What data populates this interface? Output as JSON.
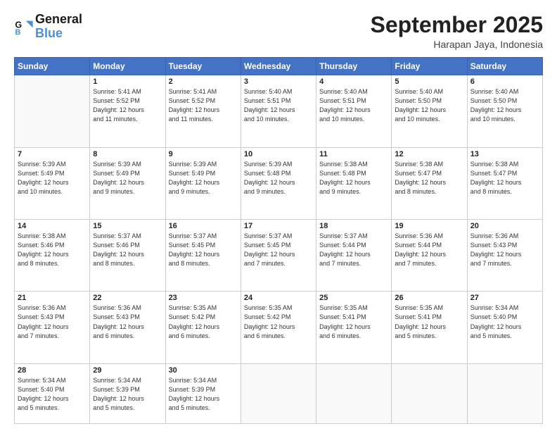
{
  "header": {
    "logo_line1": "General",
    "logo_line2": "Blue",
    "month": "September 2025",
    "location": "Harapan Jaya, Indonesia"
  },
  "days_of_week": [
    "Sunday",
    "Monday",
    "Tuesday",
    "Wednesday",
    "Thursday",
    "Friday",
    "Saturday"
  ],
  "weeks": [
    [
      {
        "day": "",
        "info": ""
      },
      {
        "day": "1",
        "info": "Sunrise: 5:41 AM\nSunset: 5:52 PM\nDaylight: 12 hours\nand 11 minutes."
      },
      {
        "day": "2",
        "info": "Sunrise: 5:41 AM\nSunset: 5:52 PM\nDaylight: 12 hours\nand 11 minutes."
      },
      {
        "day": "3",
        "info": "Sunrise: 5:40 AM\nSunset: 5:51 PM\nDaylight: 12 hours\nand 10 minutes."
      },
      {
        "day": "4",
        "info": "Sunrise: 5:40 AM\nSunset: 5:51 PM\nDaylight: 12 hours\nand 10 minutes."
      },
      {
        "day": "5",
        "info": "Sunrise: 5:40 AM\nSunset: 5:50 PM\nDaylight: 12 hours\nand 10 minutes."
      },
      {
        "day": "6",
        "info": "Sunrise: 5:40 AM\nSunset: 5:50 PM\nDaylight: 12 hours\nand 10 minutes."
      }
    ],
    [
      {
        "day": "7",
        "info": "Sunrise: 5:39 AM\nSunset: 5:49 PM\nDaylight: 12 hours\nand 10 minutes."
      },
      {
        "day": "8",
        "info": "Sunrise: 5:39 AM\nSunset: 5:49 PM\nDaylight: 12 hours\nand 9 minutes."
      },
      {
        "day": "9",
        "info": "Sunrise: 5:39 AM\nSunset: 5:49 PM\nDaylight: 12 hours\nand 9 minutes."
      },
      {
        "day": "10",
        "info": "Sunrise: 5:39 AM\nSunset: 5:48 PM\nDaylight: 12 hours\nand 9 minutes."
      },
      {
        "day": "11",
        "info": "Sunrise: 5:38 AM\nSunset: 5:48 PM\nDaylight: 12 hours\nand 9 minutes."
      },
      {
        "day": "12",
        "info": "Sunrise: 5:38 AM\nSunset: 5:47 PM\nDaylight: 12 hours\nand 8 minutes."
      },
      {
        "day": "13",
        "info": "Sunrise: 5:38 AM\nSunset: 5:47 PM\nDaylight: 12 hours\nand 8 minutes."
      }
    ],
    [
      {
        "day": "14",
        "info": "Sunrise: 5:38 AM\nSunset: 5:46 PM\nDaylight: 12 hours\nand 8 minutes."
      },
      {
        "day": "15",
        "info": "Sunrise: 5:37 AM\nSunset: 5:46 PM\nDaylight: 12 hours\nand 8 minutes."
      },
      {
        "day": "16",
        "info": "Sunrise: 5:37 AM\nSunset: 5:45 PM\nDaylight: 12 hours\nand 8 minutes."
      },
      {
        "day": "17",
        "info": "Sunrise: 5:37 AM\nSunset: 5:45 PM\nDaylight: 12 hours\nand 7 minutes."
      },
      {
        "day": "18",
        "info": "Sunrise: 5:37 AM\nSunset: 5:44 PM\nDaylight: 12 hours\nand 7 minutes."
      },
      {
        "day": "19",
        "info": "Sunrise: 5:36 AM\nSunset: 5:44 PM\nDaylight: 12 hours\nand 7 minutes."
      },
      {
        "day": "20",
        "info": "Sunrise: 5:36 AM\nSunset: 5:43 PM\nDaylight: 12 hours\nand 7 minutes."
      }
    ],
    [
      {
        "day": "21",
        "info": "Sunrise: 5:36 AM\nSunset: 5:43 PM\nDaylight: 12 hours\nand 7 minutes."
      },
      {
        "day": "22",
        "info": "Sunrise: 5:36 AM\nSunset: 5:43 PM\nDaylight: 12 hours\nand 6 minutes."
      },
      {
        "day": "23",
        "info": "Sunrise: 5:35 AM\nSunset: 5:42 PM\nDaylight: 12 hours\nand 6 minutes."
      },
      {
        "day": "24",
        "info": "Sunrise: 5:35 AM\nSunset: 5:42 PM\nDaylight: 12 hours\nand 6 minutes."
      },
      {
        "day": "25",
        "info": "Sunrise: 5:35 AM\nSunset: 5:41 PM\nDaylight: 12 hours\nand 6 minutes."
      },
      {
        "day": "26",
        "info": "Sunrise: 5:35 AM\nSunset: 5:41 PM\nDaylight: 12 hours\nand 5 minutes."
      },
      {
        "day": "27",
        "info": "Sunrise: 5:34 AM\nSunset: 5:40 PM\nDaylight: 12 hours\nand 5 minutes."
      }
    ],
    [
      {
        "day": "28",
        "info": "Sunrise: 5:34 AM\nSunset: 5:40 PM\nDaylight: 12 hours\nand 5 minutes."
      },
      {
        "day": "29",
        "info": "Sunrise: 5:34 AM\nSunset: 5:39 PM\nDaylight: 12 hours\nand 5 minutes."
      },
      {
        "day": "30",
        "info": "Sunrise: 5:34 AM\nSunset: 5:39 PM\nDaylight: 12 hours\nand 5 minutes."
      },
      {
        "day": "",
        "info": ""
      },
      {
        "day": "",
        "info": ""
      },
      {
        "day": "",
        "info": ""
      },
      {
        "day": "",
        "info": ""
      }
    ]
  ]
}
